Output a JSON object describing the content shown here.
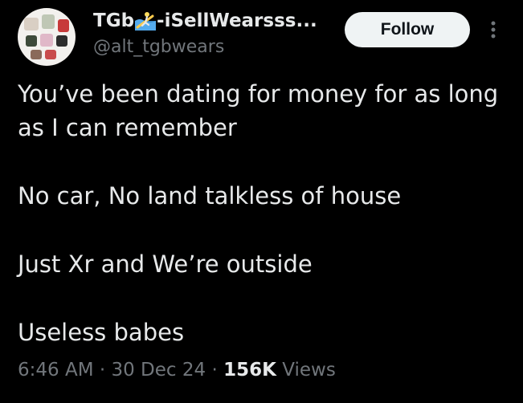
{
  "author": {
    "display_name_prefix": "TGb",
    "display_name_suffix": "-iSellWearsss...",
    "handle": "@alt_tgbwears",
    "avatar_icon": "avatar-collage-icon"
  },
  "actions": {
    "follow_label": "Follow",
    "more_icon": "more-vertical-icon"
  },
  "tweet": {
    "line1": "You’ve been dating for money for as long",
    "line2": "as I can remember",
    "line3": "No car, No land talkless of house",
    "line4": "Just Xr and We’re outside",
    "line5": "Useless babes"
  },
  "meta": {
    "time": "6:46 AM",
    "separator1": " · ",
    "date": "30 Dec 24",
    "separator2": " · ",
    "views_count": "156K",
    "views_label": " Views"
  },
  "colors": {
    "background": "#000000",
    "primary_text": "#e7e9ea",
    "secondary_text": "#71767b",
    "button_bg": "#eff3f4"
  }
}
